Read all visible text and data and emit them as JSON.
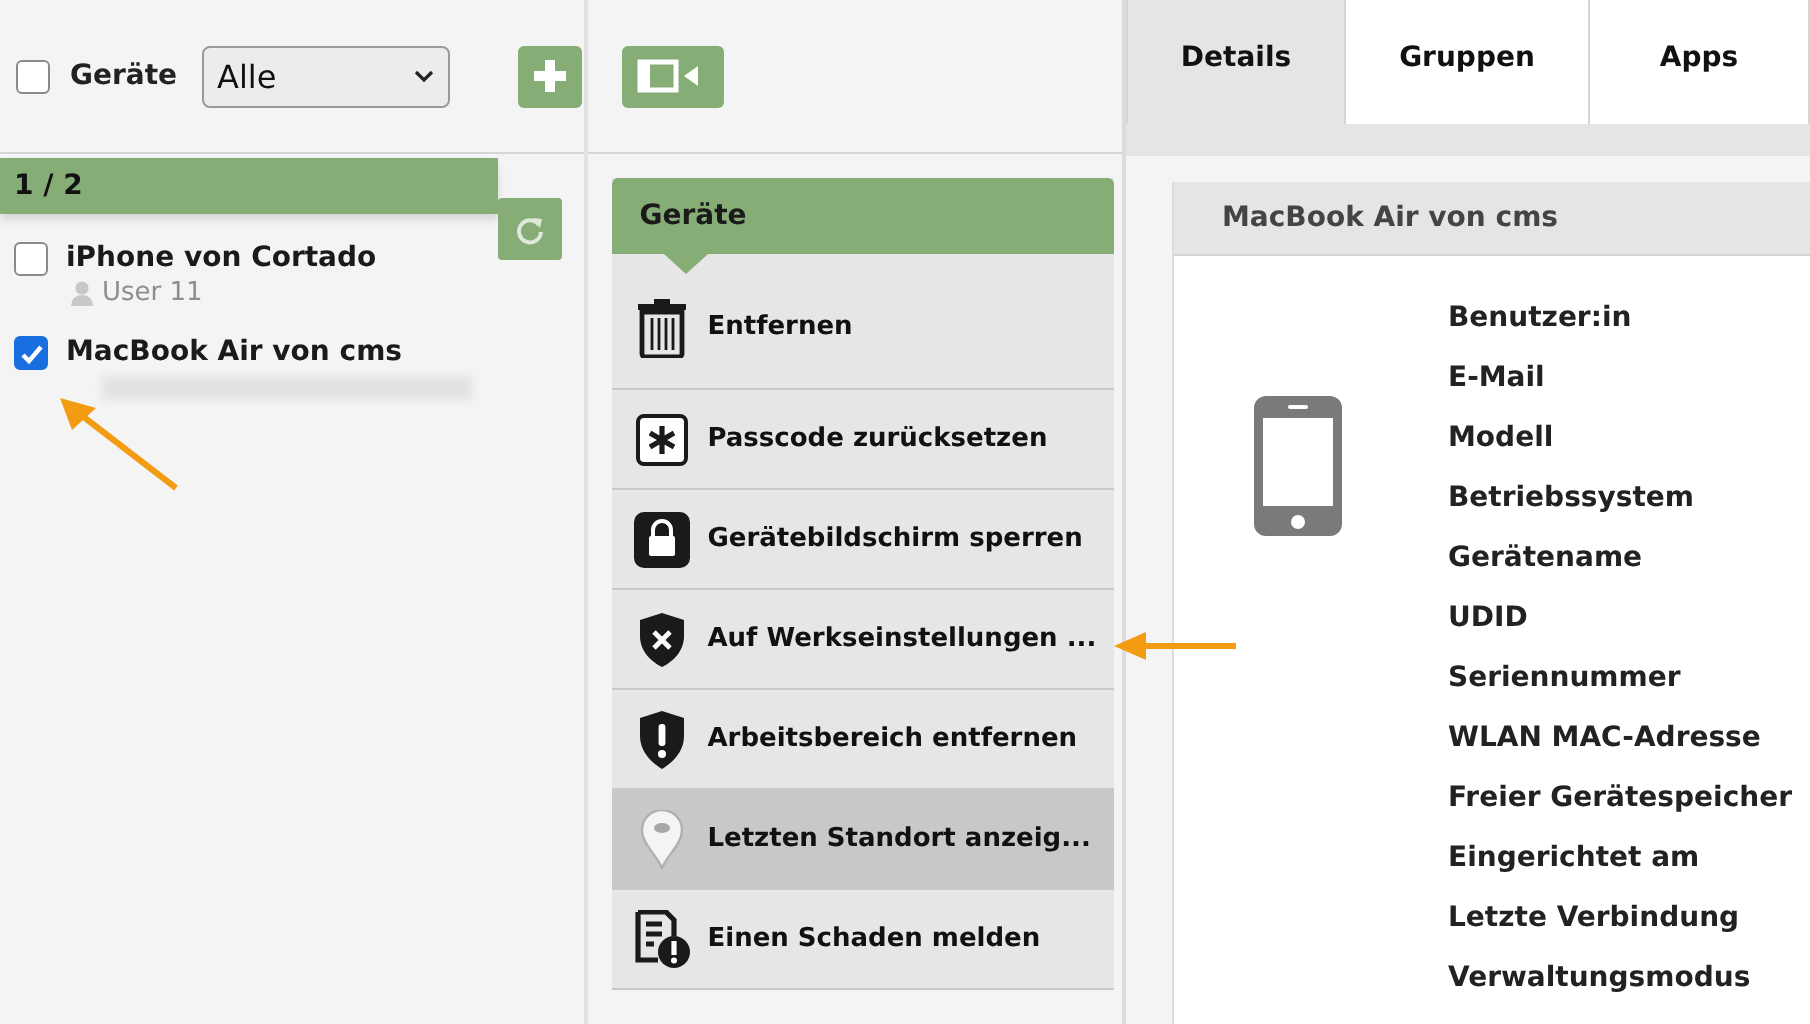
{
  "device_list": {
    "select_all": {
      "label": "Geräte",
      "checked": false
    },
    "filter": {
      "value": "Alle"
    },
    "counter": "1 / 2",
    "devices": [
      {
        "name": "iPhone von Cortado",
        "user": "User 11",
        "checked": false
      },
      {
        "name": "MacBook Air von cms",
        "checked": true
      }
    ]
  },
  "actions": {
    "title": "Geräte",
    "items": [
      {
        "label": "Entfernen",
        "selected": false
      },
      {
        "label": "Passcode zurücksetzen",
        "selected": false
      },
      {
        "label": "Gerätebildschirm sperren",
        "selected": false
      },
      {
        "label": "Auf Werkseinstellungen ...",
        "selected": false
      },
      {
        "label": "Arbeitsbereich entfernen",
        "selected": false
      },
      {
        "label": "Letzten Standort anzeig...",
        "selected": true
      },
      {
        "label": "Einen Schaden melden",
        "selected": false
      }
    ]
  },
  "tabs": [
    {
      "label": "Details",
      "selected": true
    },
    {
      "label": "Gruppen",
      "selected": false
    },
    {
      "label": "Apps",
      "selected": false
    }
  ],
  "details": {
    "title": "MacBook Air von cms",
    "fields": [
      "Benutzer:in",
      "E-Mail",
      "Modell",
      "Betriebssystem",
      "Gerätename",
      "UDID",
      "Seriennummer",
      "WLAN MAC-Adresse",
      "Freier Gerätespeicher",
      "Eingerichtet am",
      "Letzte Verbindung",
      "Verwaltungsmodus"
    ]
  }
}
